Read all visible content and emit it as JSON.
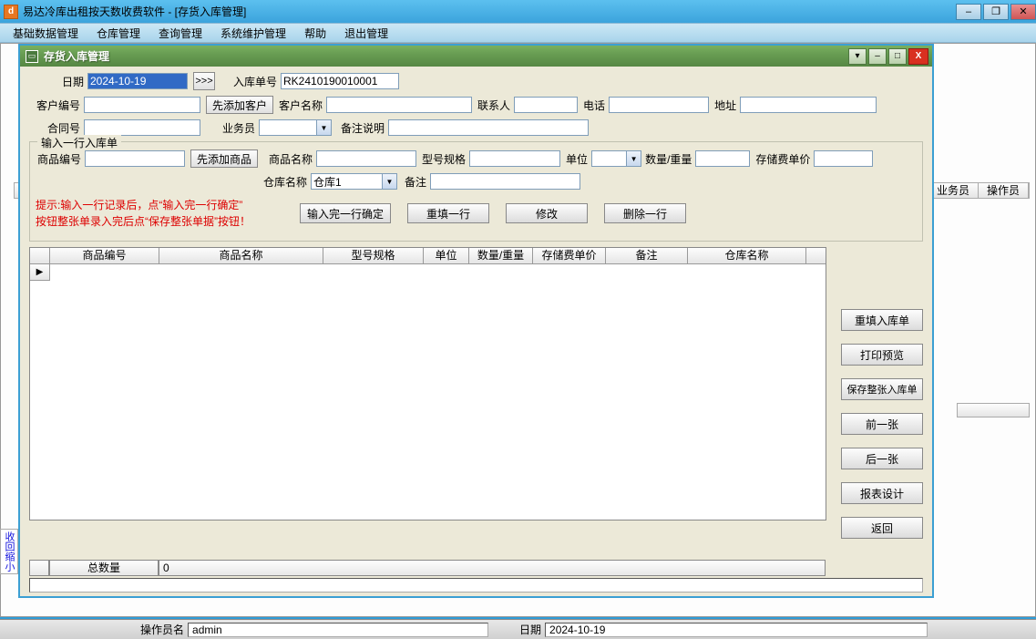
{
  "app": {
    "icon_letter": "d",
    "title": "易达冷库出租按天数收费软件   - [存货入库管理]"
  },
  "menu": [
    "基础数据管理",
    "仓库管理",
    "查询管理",
    "系统维护管理",
    "帮助",
    "退出管理"
  ],
  "bg_headers": {
    "c1": "业务员",
    "c2": "操作员"
  },
  "child": {
    "title": "存货入库管理"
  },
  "form": {
    "date_label": "日期",
    "date_value": "2024-10-19",
    "arrow_label": ">>>",
    "inbound_no_label": "入库单号",
    "inbound_no_value": "RK2410190010001",
    "cust_no_label": "客户编号",
    "add_cust_btn": "先添加客户",
    "cust_name_label": "客户名称",
    "contact_label": "联系人",
    "phone_label": "电话",
    "addr_label": "地址",
    "contract_label": "合同号",
    "salesman_label": "业务员",
    "remark_label": "备注说明"
  },
  "line": {
    "legend": "输入一行入库单",
    "product_no_label": "商品编号",
    "add_product_btn": "先添加商品",
    "product_name_label": "商品名称",
    "spec_label": "型号规格",
    "unit_label": "单位",
    "qty_label": "数量/重量",
    "storage_price_label": "存储费单价",
    "warehouse_label": "仓库名称",
    "warehouse_value": "仓库1",
    "note_label": "备注"
  },
  "hint": {
    "line1": "提示:输入一行记录后，点“输入完一行确定”",
    "line2": "按钮整张单录入完后点“保存整张单据”按钮！"
  },
  "actions": {
    "confirm": "输入完一行确定",
    "refill": "重填一行",
    "modify": "修改",
    "delete": "删除一行"
  },
  "grid": {
    "headers": [
      "商品编号",
      "商品名称",
      "型号规格",
      "单位",
      "数量/重量",
      "存储费单价",
      "备注",
      "仓库名称"
    ]
  },
  "side": {
    "refill_all": "重填入库单",
    "print": "打印预览",
    "save_all": "保存整张入库单",
    "prev": "前一张",
    "next": "后一张",
    "report": "报表设计",
    "back": "返回"
  },
  "totals": {
    "label": "总数量",
    "value": "0"
  },
  "left_tab": "收回缩小",
  "status": {
    "operator_label": "操作员名",
    "operator_value": "admin",
    "date_label": "日期",
    "date_value": "2024-10-19"
  }
}
